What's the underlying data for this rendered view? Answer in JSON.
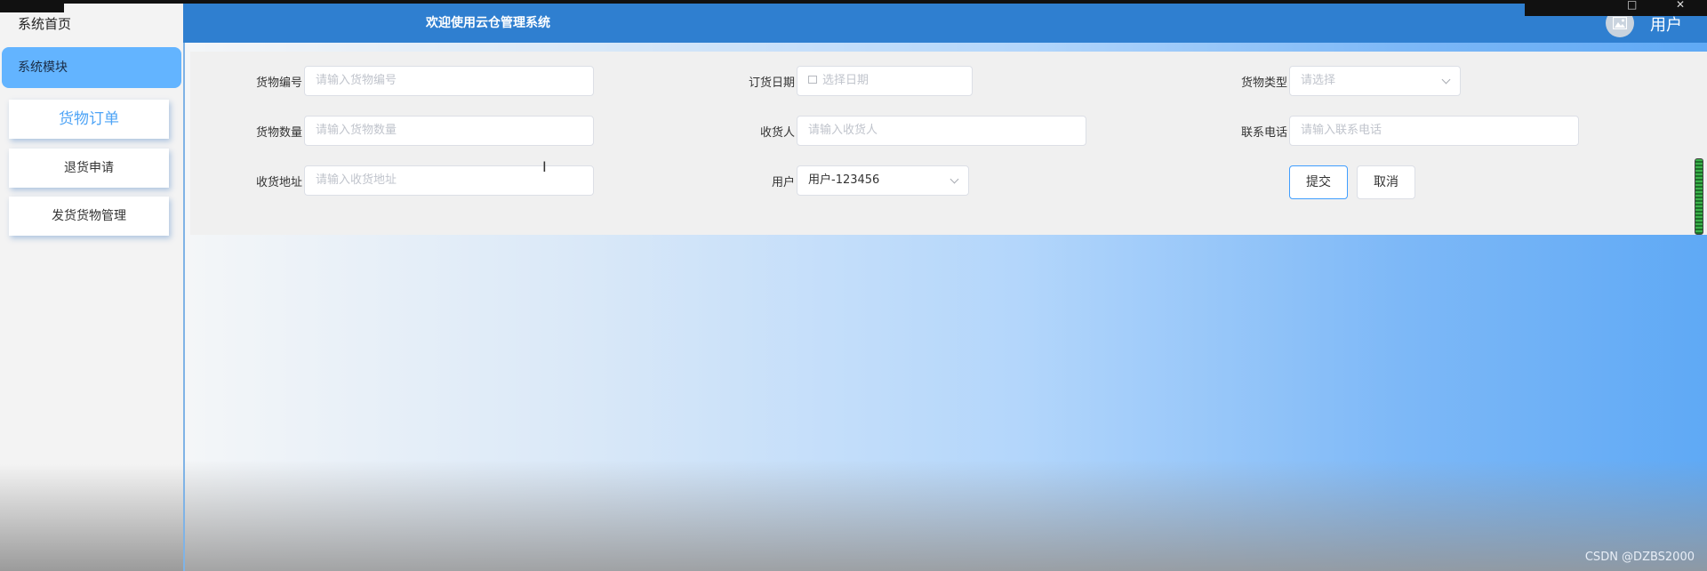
{
  "header": {
    "title": "欢迎使用云仓管理系统",
    "user_label": "用户"
  },
  "sidebar": {
    "home_label": "系统首页",
    "module_label": "系统模块",
    "items": [
      {
        "label": "货物订单",
        "active": true
      },
      {
        "label": "退货申请",
        "active": false
      },
      {
        "label": "发货货物管理",
        "active": false
      }
    ]
  },
  "form": {
    "goods_no": {
      "label": "货物编号",
      "placeholder": "请输入货物编号"
    },
    "order_date": {
      "label": "订货日期",
      "placeholder": "选择日期"
    },
    "goods_type": {
      "label": "货物类型",
      "placeholder": "请选择"
    },
    "quantity": {
      "label": "货物数量",
      "placeholder": "请输入货物数量"
    },
    "receiver": {
      "label": "收货人",
      "placeholder": "请输入收货人"
    },
    "phone": {
      "label": "联系电话",
      "placeholder": "请输入联系电话"
    },
    "address": {
      "label": "收货地址",
      "placeholder": "请输入收货地址"
    },
    "user": {
      "label": "用户",
      "value": "用户-123456"
    },
    "submit_label": "提交",
    "cancel_label": "取消"
  },
  "watermark": "CSDN @DZBS2000",
  "colors": {
    "header_bg": "#2f7fd0",
    "module_bg": "#63b4ff",
    "active_item": "#4ea4f6",
    "primary_border": "#409eff"
  }
}
